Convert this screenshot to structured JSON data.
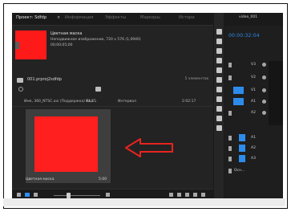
{
  "project_panel": {
    "tabs": [
      {
        "label": "Проект: Sdfdp",
        "active": true
      },
      {
        "label": "Информация",
        "active": false
      },
      {
        "label": "Эффекты",
        "active": false
      },
      {
        "label": "Маркеры",
        "active": false
      },
      {
        "label": "Истори",
        "active": false
      }
    ],
    "close_glyph": "×",
    "preview": {
      "name": "Цветная маска",
      "meta": "Неподвижное изображение, 720 x 576 (1,0940)",
      "timecode": "00;00;05;00"
    },
    "project_file": "001.prproj2sdfdp",
    "item_count": "5 элементов",
    "search": {
      "placeholder": "",
      "value": ""
    },
    "columns": {
      "name": "Имя, 360_NTSC.avi (Поддержка) Кол...",
      "fps": "44,25",
      "media": "Интервал",
      "duration": "2:02:17"
    },
    "tile": {
      "label": "Цветная маска",
      "duration": "5:00"
    }
  },
  "timeline_panel": {
    "title": "video_001",
    "timecode": "00:00:32:04",
    "tracks": [
      "V3",
      "V2",
      "V1",
      "A1",
      "A2",
      "A3",
      "Осн..."
    ]
  },
  "colors": {
    "accent_blue": "#2d8ceb",
    "mask_red": "#ff1f1f",
    "arrow_red": "#e8231f"
  }
}
